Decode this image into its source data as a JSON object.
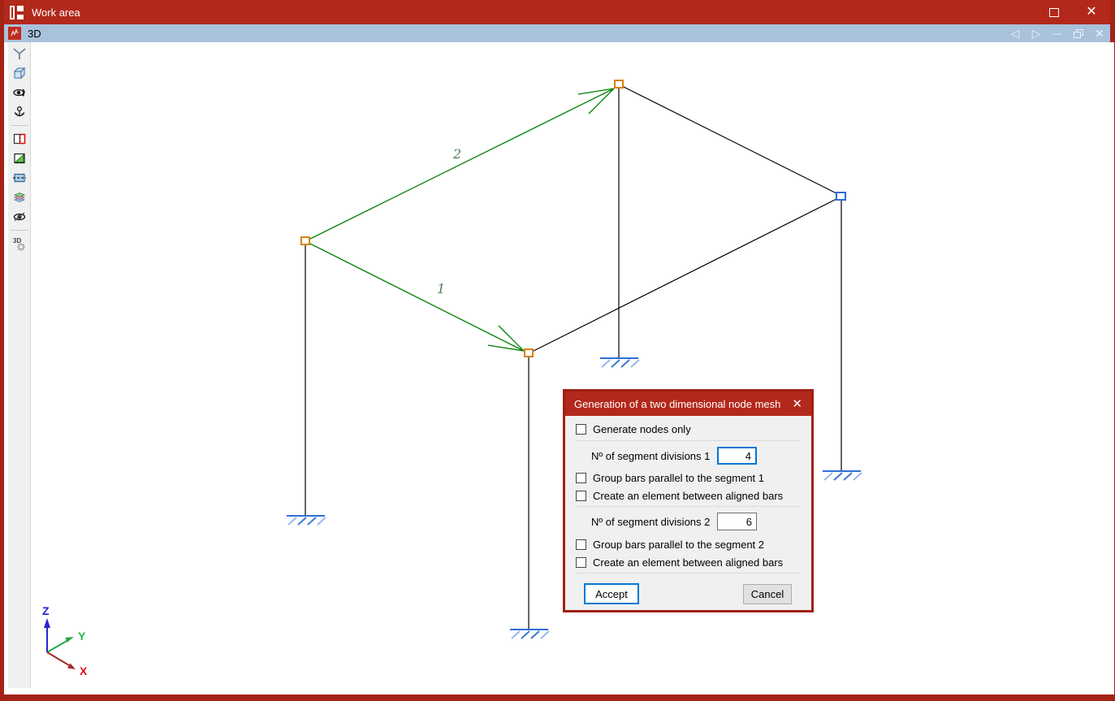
{
  "window": {
    "title": "Work area",
    "icons": {
      "maximize": "maximize-icon",
      "close": "close-icon"
    },
    "close_glyph": "✕"
  },
  "subwindow": {
    "title": "3D",
    "icons": {
      "back": "nav-back-icon",
      "forward": "nav-forward-icon",
      "minimize": "minimize-icon",
      "restore": "restore-icon",
      "close": "close-icon"
    },
    "back_glyph": "◁",
    "forward_glyph": "▷",
    "minimize_glyph": "—",
    "close_glyph": "✕"
  },
  "toolbar": {
    "items": [
      "axes-tripod",
      "cube-view",
      "orbit-view",
      "rotate-view",
      "split-view",
      "section-plane",
      "clip-plane",
      "layers",
      "hide-elements",
      "3d-settings"
    ]
  },
  "canvas": {
    "segment1_label": "1",
    "segment2_label": "2",
    "axes": {
      "x": "X",
      "y": "Y",
      "z": "Z"
    }
  },
  "dialog": {
    "title": "Generation of a two dimensional node mesh",
    "close_glyph": "✕",
    "checkbox_generate_nodes_only": "Generate nodes only",
    "divisions1": {
      "label": "Nº of segment divisions 1",
      "value": "4"
    },
    "checkbox_group_bars_1": "Group bars parallel to the segment 1",
    "checkbox_create_element_1": "Create an element between aligned bars",
    "divisions2": {
      "label": "Nº of segment divisions 2",
      "value": "6"
    },
    "checkbox_group_bars_2": "Group bars parallel to the segment 2",
    "checkbox_create_element_2": "Create an element between aligned bars",
    "accept_label": "Accept",
    "cancel_label": "Cancel"
  },
  "colors": {
    "titlebar_red": "#b2291c",
    "window_border_red": "#a42315",
    "subbar_blue": "#a9c2dc",
    "accent_blue": "#0078d7",
    "structure_green": "#007f00",
    "node_orange": "#d9820f",
    "node_blue": "#2f6fd6",
    "support_blue": "#2f6fd6",
    "axis_x_red": "#c81414",
    "axis_y_green": "#22aa44",
    "axis_z_blue": "#2727cc"
  }
}
